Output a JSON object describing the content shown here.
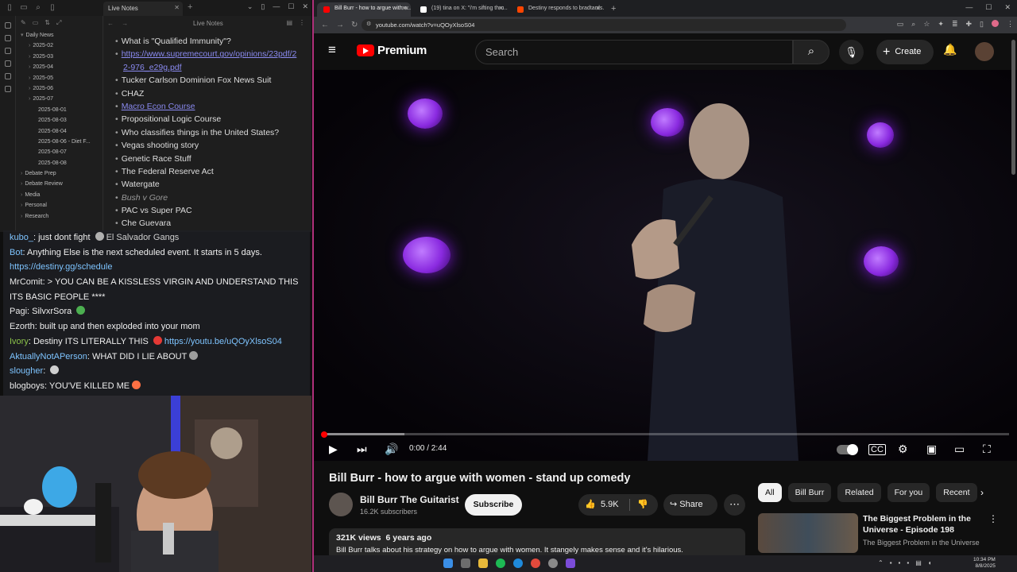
{
  "obsidian": {
    "tab_title": "Live Notes",
    "note_title": "Live Notes",
    "explorer": [
      {
        "label": "Daily News",
        "arrow": "▾",
        "indent": 0
      },
      {
        "label": "2025-02",
        "arrow": "›",
        "indent": 1
      },
      {
        "label": "2025-03",
        "arrow": "›",
        "indent": 1
      },
      {
        "label": "2025-04",
        "arrow": "›",
        "indent": 1
      },
      {
        "label": "2025-05",
        "arrow": "›",
        "indent": 1
      },
      {
        "label": "2025-06",
        "arrow": "›",
        "indent": 1
      },
      {
        "label": "2025-07",
        "arrow": "›",
        "indent": 1
      },
      {
        "label": "2025-08-01",
        "arrow": "",
        "indent": 1
      },
      {
        "label": "2025-08-03",
        "arrow": "",
        "indent": 1
      },
      {
        "label": "2025-08-04",
        "arrow": "",
        "indent": 1
      },
      {
        "label": "2025-08-06 - Diet F...",
        "arrow": "",
        "indent": 1
      },
      {
        "label": "2025-08-07",
        "arrow": "",
        "indent": 1
      },
      {
        "label": "2025-08-08",
        "arrow": "",
        "indent": 1
      },
      {
        "label": "Debate Prep",
        "arrow": "›",
        "indent": 0
      },
      {
        "label": "Debate Review",
        "arrow": "›",
        "indent": 0
      },
      {
        "label": "Media",
        "arrow": "›",
        "indent": 0
      },
      {
        "label": "Personal",
        "arrow": "›",
        "indent": 0
      },
      {
        "label": "Research",
        "arrow": "›",
        "indent": 0
      }
    ],
    "notes": [
      {
        "text": "What is \"Qualified Immunity\"?",
        "style": ""
      },
      {
        "text": "https://www.supremecourt.gov/opinions/23pdf/2",
        "style": "link"
      },
      {
        "text": "2-976_e29g.pdf",
        "style": "link-cont"
      },
      {
        "text": "Tucker Carlson Dominion Fox News Suit",
        "style": ""
      },
      {
        "text": "CHAZ",
        "style": ""
      },
      {
        "text": "Macro Econ Course",
        "style": "link"
      },
      {
        "text": "Propositional Logic Course",
        "style": ""
      },
      {
        "text": "Who classifies things in the United States?",
        "style": ""
      },
      {
        "text": "Vegas shooting story",
        "style": ""
      },
      {
        "text": "Genetic Race Stuff",
        "style": ""
      },
      {
        "text": "The Federal Reserve Act",
        "style": ""
      },
      {
        "text": "Watergate",
        "style": ""
      },
      {
        "text": "Bush v Gore",
        "style": "italic"
      },
      {
        "text": "PAC vs Super PAC",
        "style": ""
      },
      {
        "text": "Che Guevara",
        "style": ""
      }
    ]
  },
  "chat": [
    {
      "user": "kubo_",
      "user_color": "#7ec4ff",
      "text": ": just dont fight ",
      "emote": "#b0b0b0",
      "tail": "El Salvador Gangs",
      "link": ""
    },
    {
      "user": "Bot",
      "user_color": "#7ec4ff",
      "text": ": Anything Else is the next scheduled event. It starts in 5 days.",
      "emote": "",
      "tail": "",
      "link": ""
    },
    {
      "user": "",
      "user_color": "#7ec4ff",
      "text": "",
      "emote": "",
      "tail": "",
      "link": "https://destiny.gg/schedule"
    },
    {
      "user": "MrComit",
      "user_color": "#e8e8e8",
      "text": ": > YOU CAN BE A KISSLESS VIRGIN AND UNDERSTAND THIS",
      "emote": "",
      "tail": "",
      "link": ""
    },
    {
      "user": "",
      "user_color": "#e8e8e8",
      "text": "ITS BASIC PEOPLE ****",
      "emote": "",
      "tail": "",
      "link": ""
    },
    {
      "user": "Pagi",
      "user_color": "#e8e8e8",
      "text": ": SilvxrSora ",
      "emote": "#4caf50",
      "tail": "",
      "link": ""
    },
    {
      "user": "Ezorth",
      "user_color": "#e8e8e8",
      "text": ": built up and then exploded into your mom ",
      "emote": "",
      "tail": "",
      "link": ""
    },
    {
      "user": "Ivory",
      "user_color": "#8bc34a",
      "text": ": Destiny ITS LITERALLY THIS ",
      "emote": "#e53935",
      "tail": "",
      "link": "https://youtu.be/uQOyXlsoS04"
    },
    {
      "user": "AktuallyNotAPerson",
      "user_color": "#7ec4ff",
      "text": ": WHAT DID I LIE ABOUT",
      "emote": "#9e9e9e",
      "tail": "",
      "link": ""
    },
    {
      "user": "slougher",
      "user_color": "#7ec4ff",
      "text": ": ",
      "emote": "#cfcfcf",
      "tail": "",
      "link": ""
    },
    {
      "user": "blogboys",
      "user_color": "#e8e8e8",
      "text": ": YOU'VE KILLED ME",
      "emote": "#ff7043",
      "tail": "",
      "link": ""
    }
  ],
  "browser": {
    "tabs": [
      {
        "title": "Bill Burr - how to argue with w...",
        "active": true,
        "fav_color": "#ff0000"
      },
      {
        "title": "(19) tina on X: \"i'm sifting thru...",
        "active": false,
        "fav_color": "#ffffff"
      },
      {
        "title": "Destiny responds to bradtards...",
        "active": false,
        "fav_color": "#ff4500"
      }
    ],
    "url": "youtube.com/watch?v=uQOyXlsoS04"
  },
  "youtube": {
    "logo_text": "Premium",
    "search_placeholder": "Search",
    "create_label": "Create",
    "time": "0:00 / 2:44",
    "progress": 0.004,
    "buffered": 0.12,
    "video_title": "Bill Burr - how to argue with women - stand up comedy",
    "channel_name": "Bill Burr The Guitarist",
    "subscribers": "16.2K subscribers",
    "subscribe_label": "Subscribe",
    "likes": "5.9K",
    "share_label": "Share",
    "views": "321K views",
    "age": "6 years ago",
    "description": "Bill Burr talks about his strategy on how to argue with women. It stangely makes sense and it's hilarious.",
    "chips": [
      {
        "label": "All",
        "active": true
      },
      {
        "label": "Bill Burr",
        "active": false
      },
      {
        "label": "Related",
        "active": false
      },
      {
        "label": "For you",
        "active": false
      },
      {
        "label": "Recent",
        "active": false
      }
    ],
    "rec_title": "The Biggest Problem in the Universe - Episode 198",
    "rec_channel": "The Biggest Problem in the Universe"
  },
  "taskbar": {
    "time": "10:34 PM",
    "date": "8/8/2025"
  },
  "colors": {
    "accent": "#ff0000",
    "link": "#8a8af0",
    "purple_light": "#8a2ae0"
  }
}
